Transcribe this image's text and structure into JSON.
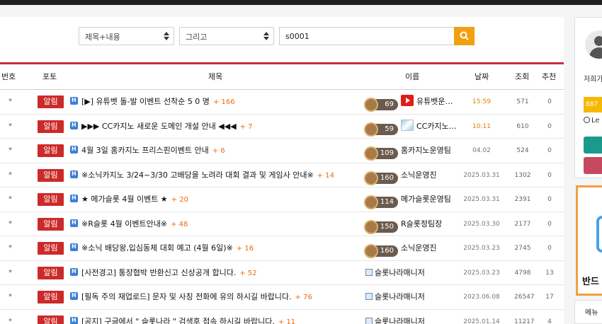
{
  "search": {
    "field_select": "제목+내용",
    "operator_select": "그리고",
    "query": "s0001"
  },
  "table": {
    "headers": {
      "num": "번호",
      "photo": "포토",
      "title": "제목",
      "name": "이름",
      "date": "날짜",
      "views": "조회",
      "rec": "추천"
    },
    "rows": [
      {
        "num": "*",
        "badge": "알림",
        "title": "[▶] 유튜벳 돌-발 이벤트 선착순 5 0 명",
        "count": "+ 166",
        "level": "69",
        "avatar": "youtube",
        "name": "유튜벳운…",
        "date": "15:59",
        "date_hot": true,
        "views": "571",
        "rec": "0"
      },
      {
        "num": "*",
        "badge": "알림",
        "title": "▶▶▶ CC카지노 새로운 도메인 개설 안내 ◀◀◀",
        "count": "+ 7",
        "level": "59",
        "avatar": "cc",
        "name": "CC카지노…",
        "date": "10:11",
        "date_hot": true,
        "views": "610",
        "rec": "0"
      },
      {
        "num": "*",
        "badge": "알림",
        "title": "4월 3일 홈카지노 프리스핀이벤트 안내",
        "count": "+ 6",
        "level": "109",
        "avatar": "",
        "name": "홈카지노운영팀",
        "date": "04.02",
        "date_hot": false,
        "views": "524",
        "rec": "0"
      },
      {
        "num": "*",
        "badge": "알림",
        "title": "※소닉카지노 3/24~3/30 고배당을 노려라 대회 결과 및 게임사 안내※",
        "count": "+ 14",
        "level": "160",
        "avatar": "",
        "name": "소닉운영진",
        "date": "2025.03.31",
        "date_hot": false,
        "views": "1302",
        "rec": "0"
      },
      {
        "num": "*",
        "badge": "알림",
        "title": "★ 메가슬롯 4월 이벤트 ★",
        "count": "+ 20",
        "level": "114",
        "avatar": "",
        "name": "메가슬롯운영팀",
        "date": "2025.03.31",
        "date_hot": false,
        "views": "2391",
        "rec": "0"
      },
      {
        "num": "*",
        "badge": "알림",
        "title": "※R슬롯 4월 이벤트안내※",
        "count": "+ 48",
        "level": "150",
        "avatar": "",
        "name": "R슬롯정팀장",
        "date": "2025.03.30",
        "date_hot": false,
        "views": "2177",
        "rec": "0"
      },
      {
        "num": "*",
        "badge": "알림",
        "title": "※소닉 배당왕,입심동체 대회 예고 (4월 6일)※",
        "count": "+ 16",
        "level": "160",
        "avatar": "",
        "name": "소닉운영진",
        "date": "2025.03.23",
        "date_hot": false,
        "views": "2745",
        "rec": "0"
      },
      {
        "num": "*",
        "badge": "알림",
        "title": "[사전경고] 통장협박 반환신고 신상공개 합니다.",
        "count": "+ 52",
        "level": "",
        "avatar": "img",
        "name": "슬롯나라매니저",
        "date": "2025.03.23",
        "date_hot": false,
        "views": "4798",
        "rec": "13"
      },
      {
        "num": "*",
        "badge": "알림",
        "title": "[필독 주의 재업로드] 문자 및 사칭 전화에 유의 하시길 바랍니다.",
        "count": "+ 76",
        "level": "",
        "avatar": "img",
        "name": "슬롯나라매니저",
        "date": "2023.06.08",
        "date_hot": false,
        "views": "26547",
        "rec": "17"
      },
      {
        "num": "*",
        "badge": "알림",
        "title": "[공지] 구글에서 \" 슬롯나라 \" 검색후 접속 하시길 바랍니다.",
        "count": "+ 11",
        "level": "",
        "avatar": "img",
        "name": "슬롯나라매니저",
        "date": "2025.01.14",
        "date_hot": false,
        "views": "11217",
        "rec": "4"
      }
    ]
  },
  "side": {
    "greeting": "저희가",
    "points": "887",
    "user": "Le"
  },
  "ad": {
    "text": "반드"
  },
  "menu": {
    "label": "메뉴"
  },
  "colors": {
    "accent_red": "#cc2a2a",
    "search_orange": "#f0a010",
    "teal": "#1a9a8a",
    "rose": "#c6495f"
  }
}
